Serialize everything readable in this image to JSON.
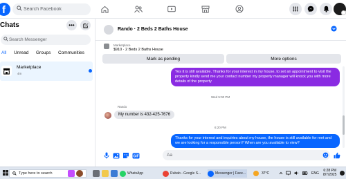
{
  "header": {
    "search_placeholder": "Search Facebook",
    "nav_icons": [
      "home-icon",
      "friends-icon",
      "watch-icon",
      "marketplace-icon",
      "groups-icon"
    ],
    "right_icons": [
      "menu-grid-icon",
      "messenger-icon",
      "bell-icon",
      "profile-avatar"
    ]
  },
  "sidebar": {
    "title": "Chats",
    "search_placeholder": "Search Messenger",
    "filters": [
      "All",
      "Unread",
      "Groups",
      "Communities"
    ],
    "active_filter": "All",
    "conversation": {
      "title": "Marketplace",
      "time": "4m"
    }
  },
  "chat": {
    "listing_title": "Rando · 2 Beds 2 Baths House",
    "context": {
      "label": "Marketplace",
      "detail": "$910 · 2 Beds 2 Baths House",
      "mark_pending": "Mark as pending",
      "more_options": "More options"
    },
    "messages": [
      {
        "type": "out",
        "text": "Yes it is still available. Thanks for your interest in my house, to set an appointment to visit the property kindly send me your contact number my property manager will knock you with more details of the property"
      },
      {
        "type": "timestamp",
        "text": "Wed 5:00 PM"
      },
      {
        "type": "in",
        "sender": "Rando",
        "text": "My number is 432-425-7676"
      },
      {
        "type": "timestamp",
        "text": "6:20 PM"
      },
      {
        "type": "out",
        "text": "Thanks for your interest and inquiries about my house, the house is still available for rent and we are looking for a responsible person? When are you available to view?"
      }
    ],
    "composer_placeholder": "Aa"
  },
  "taskbar": {
    "search_placeholder": "Type here to search",
    "apps": [
      {
        "label": "WhatsApp",
        "color": "#25d366"
      },
      {
        "label": "Rubab - Google S...",
        "color": "#ea4335"
      },
      {
        "label": "Messenger | Face...",
        "color": "#0866ff"
      }
    ],
    "temperature": "37°C",
    "language": "ENG",
    "time": "6:28 PM",
    "date": "8/7/2025"
  },
  "colors": {
    "brand": "#0866ff",
    "outgoing_bubble": "#8a2be2",
    "incoming_bubble": "#e4e6eb"
  }
}
